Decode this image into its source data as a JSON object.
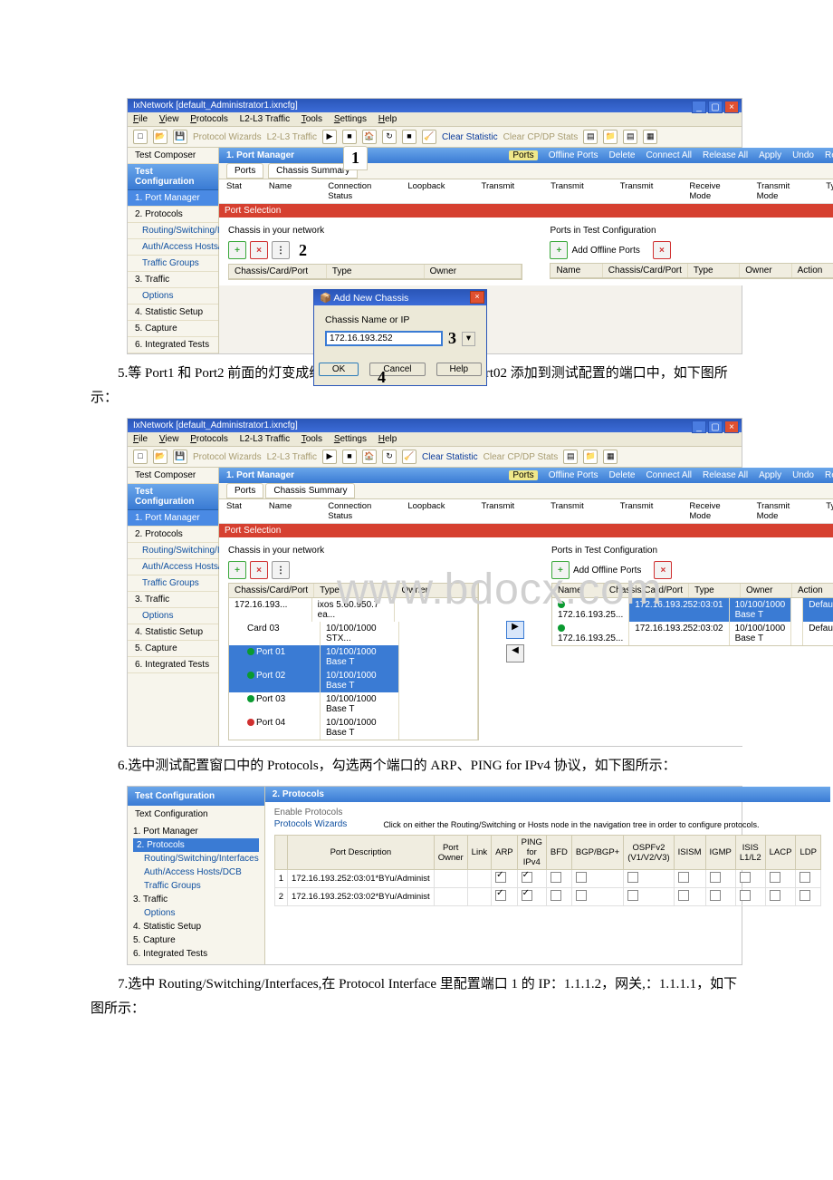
{
  "figA": {
    "title": "IxNetwork [default_Administrator1.ixncfg]",
    "menus": [
      "File",
      "View",
      "Protocols",
      "L2-L3 Traffic",
      "Tools",
      "Settings",
      "Help"
    ],
    "toolbar": {
      "stat": "Clear Statistic",
      "statsub": "Clear CP/DP Stats"
    },
    "testComposer": "Test Composer",
    "testConfiguration": "Test Configuration",
    "tree": [
      "1. Port Manager",
      "2. Protocols",
      "Routing/Switching/Interfaces",
      "Auth/Access Hosts/DCB",
      "Traffic Groups",
      "3. Traffic",
      "Options",
      "4. Statistic Setup",
      "5. Capture",
      "6. Integrated Tests"
    ],
    "rightHead": "1. Port Manager",
    "rightBtns": [
      "Ports",
      "Offline Ports",
      "Delete",
      "Connect All",
      "Release All",
      "Apply",
      "Undo",
      "Redo"
    ],
    "tabs": [
      "Ports",
      "Chassis Summary"
    ],
    "subrow": [
      "Stat",
      "Name",
      "Connection Status",
      "Loopback",
      "Transmit",
      "Transmit",
      "Transmit",
      "Receive Mode",
      "Transmit Mode",
      "Type"
    ],
    "redbar": "Port Selection",
    "leftPanel": {
      "title": "Chassis in your network",
      "cols": [
        "Chassis/Card/Port",
        "Type",
        "Owner"
      ]
    },
    "rightPanel": {
      "title": "Ports in Test Configuration",
      "add": "Add Offline Ports",
      "cols": [
        "Name",
        "Chassis/Card/Port",
        "Type",
        "Owner",
        "Action"
      ]
    },
    "ann": {
      "a": "1",
      "b": "2",
      "c": "3",
      "d": "4"
    },
    "dlg": {
      "title": "Add New Chassis",
      "label": "Chassis Name or IP",
      "ip": "172.16.193.252",
      "ok": "OK",
      "cancel": "Cancel",
      "help": "Help"
    }
  },
  "p1": "5.等 Port1 和 Port2 前面的灯变成绿色，再将其中的 Port01、Port02 添加到测试配置的端口中，如下图所示：",
  "figB": {
    "title": "IxNetwork [default_Administrator1.ixncfg]",
    "rightBtns": [
      "Ports",
      "Offline Ports",
      "Delete",
      "Connect All",
      "Release All",
      "Apply",
      "Undo",
      "Redo"
    ],
    "rows": [
      {
        "name": "172.16.193...",
        "type": "ixos 5.60.950.7 ea...",
        "g": false,
        "root": true
      },
      {
        "name": "Card 03",
        "type": "10/100/1000 STX...",
        "g": false
      },
      {
        "name": "Port 01",
        "type": "10/100/1000 Base T",
        "g": true,
        "hl": true
      },
      {
        "name": "Port 02",
        "type": "10/100/1000 Base T",
        "g": true,
        "hl": true
      },
      {
        "name": "Port 03",
        "type": "10/100/1000 Base T",
        "g": true
      },
      {
        "name": "Port 04",
        "type": "10/100/1000 Base T",
        "g": false,
        "r": true
      }
    ],
    "rrows": [
      {
        "n": "172.16.193.25...",
        "c": "172.16.193.252:03:01",
        "t": "10/100/1000 Base T",
        "a": "Default",
        "hl": true
      },
      {
        "n": "172.16.193.25...",
        "c": "172.16.193.252:03:02",
        "t": "10/100/1000 Base T",
        "a": "Default"
      }
    ],
    "watermark": "www.bdocx.com"
  },
  "p2": "6.选中测试配置窗口中的 Protocols，勾选两个端口的 ARP、PING for IPv4 协议，如下图所示：",
  "figC": {
    "testConfiguration": "Test Configuration",
    "tree": [
      "1. Port Manager",
      "2. Protocols",
      "Routing/Switching/Interfaces",
      "Auth/Access Hosts/DCB",
      "Traffic Groups",
      "3. Traffic",
      "Options",
      "4. Statistic Setup",
      "5. Capture",
      "6. Integrated Tests"
    ],
    "head": "2. Protocols",
    "en": "Enable Protocols",
    "wiz": "Protocols Wizards",
    "hint": "Click on either the Routing/Switching or Hosts node in the navigation tree in order to configure protocols.",
    "cols": [
      "",
      "Port Description",
      "Port Owner",
      "Link",
      "ARP",
      "PING for IPv4",
      "BFD",
      "BGP/BGP+",
      "OSPFv2 (V1/V2/V3)",
      "ISISM",
      "IGMP",
      "ISIS L1/L2",
      "LACP",
      "LDP"
    ],
    "r1": "172.16.193.252:03:01*BYu/Administ",
    "r2": "172.16.193.252:03:02*BYu/Administ"
  },
  "p3": "7.选中 Routing/Switching/Interfaces,在 Protocol Interface 里配置端口 1 的 IP：1.1.1.2，网关,：1.1.1.1，如下图所示："
}
